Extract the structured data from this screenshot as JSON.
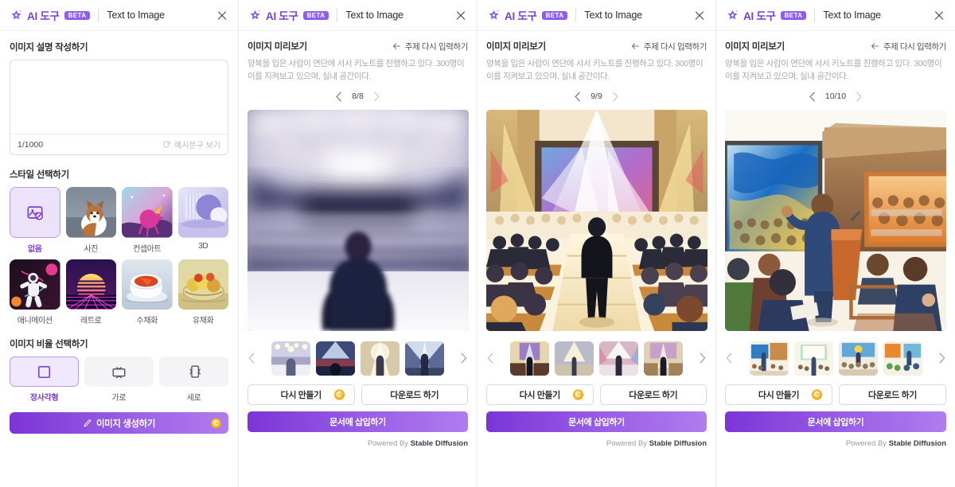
{
  "header": {
    "brand": "AI 도구",
    "beta": "BETA",
    "mode": "Text to Image",
    "close_icon": "close-icon",
    "logo_icon": "sparkle-star-icon"
  },
  "compose": {
    "section_title": "이미지 설명 작성하기",
    "textarea_value": "",
    "textarea_placeholder": "",
    "counter": "1/1000",
    "example_label": "예시문구 보기",
    "example_icon": "refresh-icon"
  },
  "style": {
    "section_title": "스타일 선택하기",
    "items": [
      {
        "label": "없음",
        "selected": true,
        "icon": "no-image-icon"
      },
      {
        "label": "사진",
        "selected": false,
        "icon": "photo-corgi-thumb"
      },
      {
        "label": "컨셉아트",
        "selected": false,
        "icon": "concept-art-pegasus-thumb"
      },
      {
        "label": "3D",
        "selected": false,
        "icon": "3d-shapes-thumb"
      },
      {
        "label": "애니메이션",
        "selected": false,
        "icon": "animation-astronaut-thumb"
      },
      {
        "label": "레트로",
        "selected": false,
        "icon": "retro-sunset-thumb"
      },
      {
        "label": "수채화",
        "selected": false,
        "icon": "watercolor-teacup-thumb"
      },
      {
        "label": "유채화",
        "selected": false,
        "icon": "oil-painting-fruit-thumb"
      }
    ]
  },
  "ratio": {
    "section_title": "이미지 비율 선택하기",
    "items": [
      {
        "label": "정사각형",
        "selected": true,
        "icon": "square-ratio-icon"
      },
      {
        "label": "가로",
        "selected": false,
        "icon": "landscape-ratio-icon"
      },
      {
        "label": "세로",
        "selected": false,
        "icon": "portrait-ratio-icon"
      }
    ]
  },
  "generate": {
    "label": "이미지 생성하기",
    "icon": "pencil-icon",
    "credit_badge": "C"
  },
  "preview": {
    "title": "이미지 미리보기",
    "back_label": "주제 다시 입력하기",
    "back_icon": "arrow-left-icon",
    "prompt": "양복을 입은 사람이 연단에 서서 키노트를 진행하고 있다. 300명이 이를 지켜보고 있으며, 실내 공간이다.",
    "prev_icon": "chevron-left-icon",
    "next_icon": "chevron-right-icon"
  },
  "panels": [
    {
      "page": "8/8",
      "image": "auditorium-speaker-photo"
    },
    {
      "page": "9/9",
      "image": "aisle-walk-illustration"
    },
    {
      "page": "10/10",
      "image": "watercolor-podium-illustration"
    }
  ],
  "actions": {
    "regenerate": "다시 만들기",
    "regenerate_badge": "C",
    "download": "다운로드 하기",
    "insert": "문서에 삽입하기"
  },
  "footer": {
    "powered_prefix": "Powered By ",
    "powered_brand": "Stable Diffusion"
  },
  "colors": {
    "brand_purple": "#7c3fd6",
    "accent_violet": "#8b5cf6",
    "gold": "#f0a90f"
  }
}
